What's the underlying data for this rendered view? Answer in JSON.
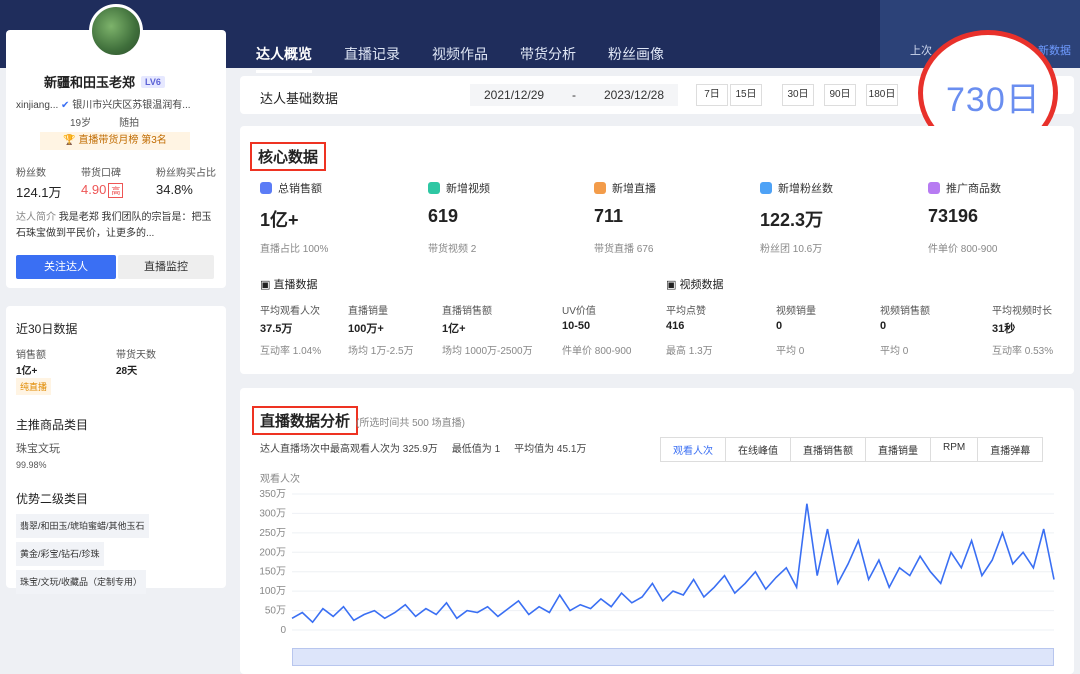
{
  "nav": {
    "tabs": [
      {
        "label": "达人概览"
      },
      {
        "label": "直播记录"
      },
      {
        "label": "视频作品"
      },
      {
        "label": "带货分析"
      },
      {
        "label": "粉丝画像"
      }
    ],
    "recent_prefix": "上次",
    "recent_link": "新数据"
  },
  "profile": {
    "name": "新疆和田玉老郑",
    "level": "LV6",
    "uid": "xinjiang...",
    "location": "银川市兴庆区苏银温润有...",
    "age": "19岁",
    "rank": "直播带货月榜 第3名",
    "mood": "随拍",
    "stats_labels": [
      "粉丝数",
      "带货口碑",
      "粉丝购买占比"
    ],
    "stats_values": [
      "124.1万",
      "4.90",
      "34.8%"
    ],
    "kb_tag": "高",
    "intro_label": "达人简介",
    "intro_text": "我是老郑 我们团队的宗旨是：把玉石珠宝做到平民价，让更多的...",
    "follow": "关注达人",
    "monitor": "直播监控"
  },
  "recent30": {
    "title": "近30日数据",
    "sales_label": "销售额",
    "sales_value": "1亿+",
    "days_label": "带货天数",
    "days_value": "28天",
    "pill": "纯直播",
    "main_cat_title": "主推商品类目",
    "main_cat": "珠宝文玩",
    "main_pct": "99.98%",
    "sec_title": "优势二级类目",
    "sec_items": [
      "翡翠/和田玉/琥珀蜜蜡/其他玉石",
      "黄金/彩宝/钻石/珍珠",
      "珠宝/文玩/收藏品（定制专用）"
    ]
  },
  "basic": {
    "title": "达人基础数据",
    "date_from": "2021/12/29",
    "date_sep": "-",
    "date_to": "2023/12/28",
    "ranges": [
      "7日",
      "15日",
      "30日",
      "90日",
      "180日"
    ],
    "highlight": "730日"
  },
  "core": {
    "title": "核心数据",
    "metrics": [
      {
        "label": "总销售额",
        "value": "1亿+",
        "sub": "直播占比 100%"
      },
      {
        "label": "新增视频",
        "value": "619",
        "sub": "带货视频 2"
      },
      {
        "label": "新增直播",
        "value": "711",
        "sub": "带货直播 676"
      },
      {
        "label": "新增粉丝数",
        "value": "122.3万",
        "sub": "粉丝团 10.6万"
      },
      {
        "label": "推广商品数",
        "value": "73196",
        "sub": "件单价 800-900"
      }
    ],
    "live_title": "直播数据",
    "video_title": "视频数据",
    "stats": [
      {
        "k": "平均观看人次",
        "v": "37.5万",
        "s": "互动率 1.04%"
      },
      {
        "k": "直播销量",
        "v": "100万+",
        "s": "场均 1万-2.5万"
      },
      {
        "k": "直播销售额",
        "v": "1亿+",
        "s": "场均 1000万-2500万"
      },
      {
        "k": "UV价值",
        "v": "10-50",
        "s": "件单价 800-900"
      },
      {
        "k": "平均点赞",
        "v": "416",
        "s": "最高 1.3万"
      },
      {
        "k": "视频销量",
        "v": "0",
        "s": "平均 0"
      },
      {
        "k": "视频销售额",
        "v": "0",
        "s": "平均 0"
      },
      {
        "k": "平均视频时长",
        "v": "31秒",
        "s": "互动率 0.53%"
      }
    ]
  },
  "live": {
    "title": "直播数据分析",
    "note": "(所选时间共 500 场直播)",
    "summary": [
      "达人直播场次中最高观看人次为 325.9万",
      "最低值为 1",
      "平均值为 45.1万"
    ],
    "tabs": [
      "观看人次",
      "在线峰值",
      "直播销售额",
      "直播销量",
      "RPM",
      "直播弹幕"
    ],
    "ylabel": "观看人次"
  },
  "chart_data": {
    "type": "line",
    "ylabel": "观看人次",
    "ylim": [
      0,
      350
    ],
    "yticks": [
      "0",
      "50万",
      "100万",
      "150万",
      "200万",
      "250万",
      "300万",
      "350万"
    ],
    "series": [
      {
        "values": [
          30,
          45,
          20,
          55,
          35,
          60,
          25,
          40,
          50,
          30,
          45,
          65,
          35,
          55,
          40,
          70,
          30,
          50,
          45,
          60,
          35,
          55,
          75,
          40,
          60,
          45,
          90,
          50,
          65,
          55,
          80,
          60,
          95,
          70,
          85,
          120,
          75,
          100,
          90,
          130,
          85,
          110,
          140,
          95,
          120,
          150,
          105,
          135,
          160,
          110,
          325,
          140,
          260,
          120,
          170,
          230,
          130,
          180,
          110,
          160,
          140,
          190,
          150,
          120,
          200,
          160,
          230,
          140,
          180,
          250,
          170,
          200,
          160,
          260,
          130
        ]
      }
    ]
  }
}
